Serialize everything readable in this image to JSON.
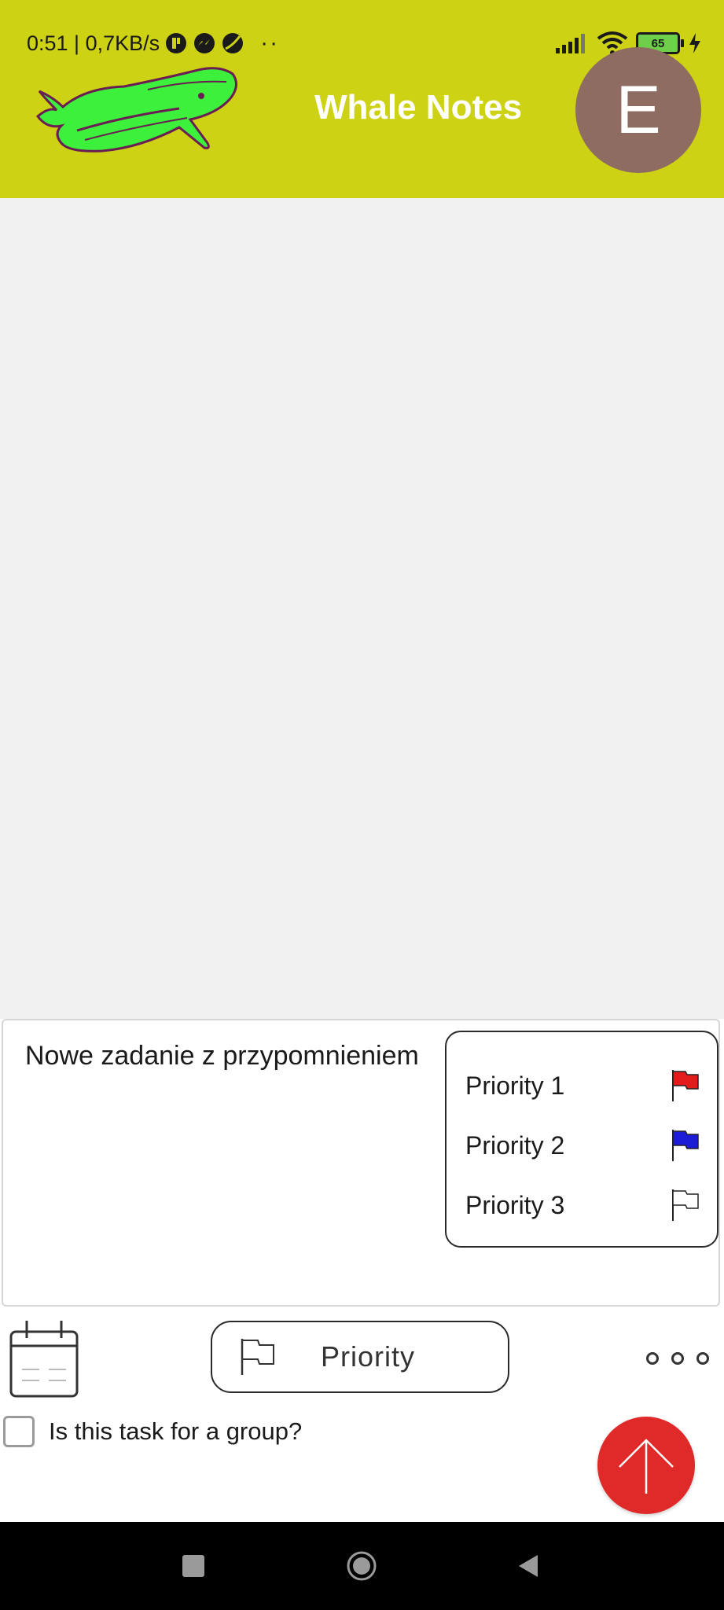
{
  "status_bar": {
    "time_speed": "0:51 | 0,7KB/s",
    "more_dots": "··",
    "battery_level": "65"
  },
  "header": {
    "title": "Whale Notes",
    "avatar_letter": "E",
    "background_color": "#cdd214"
  },
  "composer": {
    "task_text": "Nowe zadanie z przypomnieniem",
    "priority_menu": [
      {
        "label": "Priority 1",
        "flag_color": "#e31b1b"
      },
      {
        "label": "Priority 2",
        "flag_color": "#1d1dd8"
      },
      {
        "label": "Priority 3",
        "flag_color": "#ffffff"
      }
    ],
    "priority_button_label": "Priority",
    "group_checkbox_label": "Is this task for a group?",
    "group_checkbox_checked": false,
    "submit_color": "#e02a2a"
  },
  "icons": {
    "calendar": "calendar-icon",
    "flag": "flag-icon",
    "more": "more-horizontal-icon",
    "submit": "arrow-up-icon",
    "nav_recents": "square-icon",
    "nav_home": "circle-icon",
    "nav_back": "triangle-back-icon"
  }
}
